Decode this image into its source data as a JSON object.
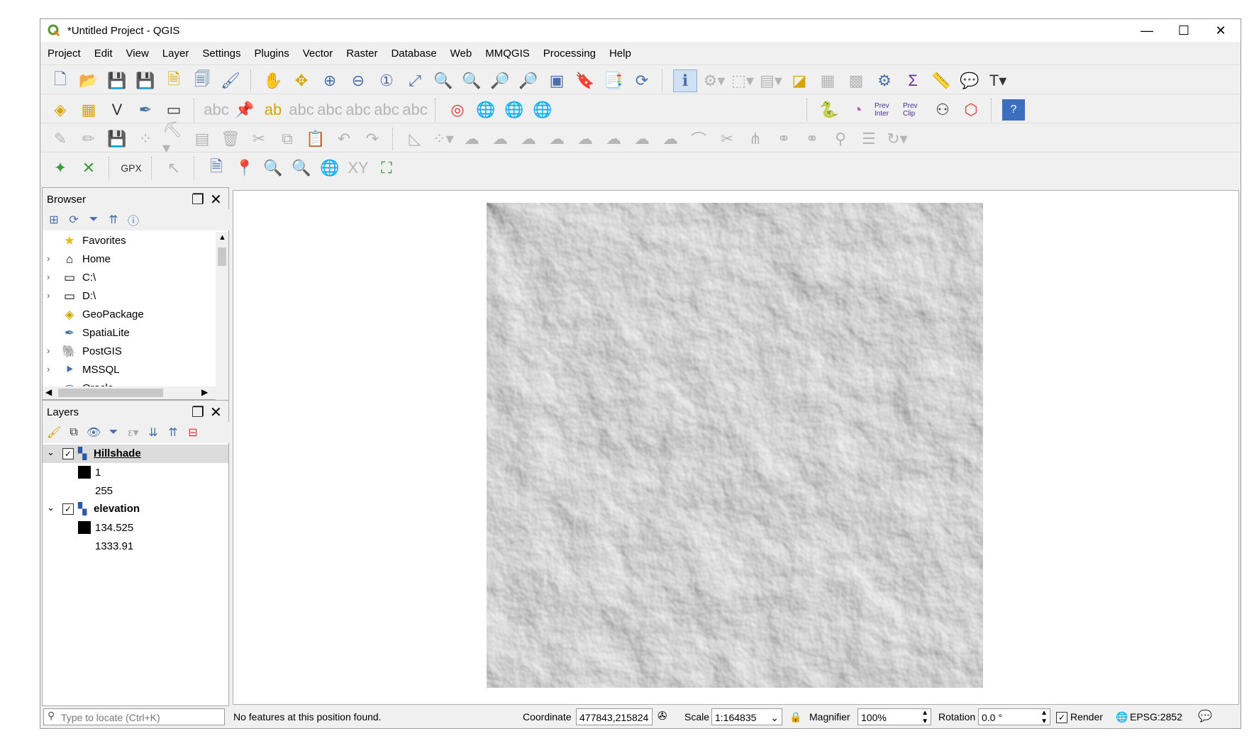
{
  "window": {
    "title": "*Untitled Project - QGIS",
    "minimize": "—",
    "maximize": "☐",
    "close": "✕"
  },
  "menu": [
    "Project",
    "Edit",
    "View",
    "Layer",
    "Settings",
    "Plugins",
    "Vector",
    "Raster",
    "Database",
    "Web",
    "MMQGIS",
    "Processing",
    "Help"
  ],
  "browser": {
    "title": "Browser",
    "items": [
      {
        "label": "Favorites",
        "icon": "star-icon",
        "expandable": false
      },
      {
        "label": "Home",
        "icon": "home-folder-icon",
        "expandable": true
      },
      {
        "label": "C:\\",
        "icon": "folder-icon",
        "expandable": true
      },
      {
        "label": "D:\\",
        "icon": "folder-icon",
        "expandable": true
      },
      {
        "label": "GeoPackage",
        "icon": "geopackage-icon",
        "expandable": false
      },
      {
        "label": "SpatiaLite",
        "icon": "spatialite-icon",
        "expandable": false
      },
      {
        "label": "PostGIS",
        "icon": "postgis-icon",
        "expandable": true
      },
      {
        "label": "MSSQL",
        "icon": "mssql-icon",
        "expandable": true
      },
      {
        "label": "Oracle",
        "icon": "oracle-icon",
        "expandable": false
      }
    ]
  },
  "layers": {
    "title": "Layers",
    "items": [
      {
        "name": "Hillshade",
        "checked": true,
        "selected": true,
        "legend": [
          "1",
          "255"
        ]
      },
      {
        "name": "elevation",
        "checked": true,
        "selected": false,
        "legend": [
          "134.525",
          "1333.91"
        ]
      }
    ]
  },
  "status": {
    "locate_placeholder": "Type to locate (Ctrl+K)",
    "message": "No features at this position found.",
    "coordinate_label": "Coordinate",
    "coordinate_value": "477843,215824",
    "scale_label": "Scale",
    "scale_value": "1:164835",
    "magnifier_label": "Magnifier",
    "magnifier_value": "100%",
    "rotation_label": "Rotation",
    "rotation_value": "0.0 °",
    "render_label": "Render",
    "render_checked": true,
    "crs": "EPSG:2852"
  },
  "colors": {
    "selected_row": "#dcdcdc",
    "active_tool": "#cfe0f4"
  }
}
